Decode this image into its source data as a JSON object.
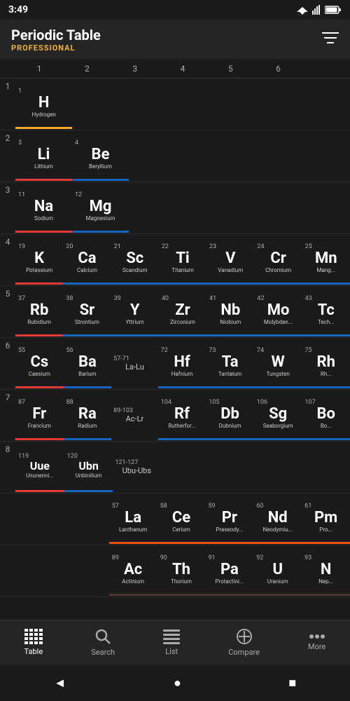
{
  "status": {
    "time": "3:49"
  },
  "header": {
    "title": "Periodic Table",
    "subtitle": "PROFESSIONAL",
    "filter_label": "filter"
  },
  "col_headers": [
    "1",
    "2",
    "3",
    "4",
    "5",
    "6"
  ],
  "periods": [
    {
      "label": "1",
      "cells": [
        {
          "num": "1",
          "symbol": "H",
          "name": "Hydrogen",
          "cat": "nonmetal",
          "col": 1
        },
        {
          "num": "",
          "symbol": "",
          "name": "",
          "cat": "empty",
          "col": 2
        },
        {
          "num": "",
          "symbol": "",
          "name": "",
          "cat": "empty",
          "col": 3
        },
        {
          "num": "",
          "symbol": "",
          "name": "",
          "cat": "empty",
          "col": 4
        },
        {
          "num": "",
          "symbol": "",
          "name": "",
          "cat": "empty",
          "col": 5
        },
        {
          "num": "",
          "symbol": "",
          "name": "",
          "cat": "empty",
          "col": 6
        }
      ]
    },
    {
      "label": "2",
      "cells": [
        {
          "num": "3",
          "symbol": "Li",
          "name": "Lithium",
          "cat": "alkali",
          "col": 1
        },
        {
          "num": "4",
          "symbol": "Be",
          "name": "Beryllium",
          "cat": "alkaline",
          "col": 2
        },
        {
          "num": "",
          "symbol": "",
          "name": "",
          "cat": "empty",
          "col": 3
        },
        {
          "num": "",
          "symbol": "",
          "name": "",
          "cat": "empty",
          "col": 4
        },
        {
          "num": "",
          "symbol": "",
          "name": "",
          "cat": "empty",
          "col": 5
        },
        {
          "num": "",
          "symbol": "",
          "name": "",
          "cat": "empty",
          "col": 6
        }
      ]
    },
    {
      "label": "3",
      "cells": [
        {
          "num": "11",
          "symbol": "Na",
          "name": "Sodium",
          "cat": "alkali",
          "col": 1
        },
        {
          "num": "12",
          "symbol": "Mg",
          "name": "Magnesium",
          "cat": "alkaline",
          "col": 2
        },
        {
          "num": "",
          "symbol": "",
          "name": "",
          "cat": "empty",
          "col": 3
        },
        {
          "num": "",
          "symbol": "",
          "name": "",
          "cat": "empty",
          "col": 4
        },
        {
          "num": "",
          "symbol": "",
          "name": "",
          "cat": "empty",
          "col": 5
        },
        {
          "num": "",
          "symbol": "",
          "name": "",
          "cat": "empty",
          "col": 6
        }
      ]
    },
    {
      "label": "4",
      "cells": [
        {
          "num": "19",
          "symbol": "K",
          "name": "Potassium",
          "cat": "alkali",
          "col": 1
        },
        {
          "num": "20",
          "symbol": "Ca",
          "name": "Calcium",
          "cat": "alkaline",
          "col": 2
        },
        {
          "num": "21",
          "symbol": "Sc",
          "name": "Scandium",
          "cat": "transition",
          "col": 3
        },
        {
          "num": "22",
          "symbol": "Ti",
          "name": "Titanium",
          "cat": "transition",
          "col": 4
        },
        {
          "num": "23",
          "symbol": "V",
          "name": "Vanadium",
          "cat": "transition",
          "col": 5
        },
        {
          "num": "24",
          "symbol": "Cr",
          "name": "Chromium",
          "cat": "transition",
          "col": 6
        },
        {
          "num": "25",
          "symbol": "Mn",
          "name": "Mang...",
          "cat": "transition",
          "col": 7
        }
      ]
    },
    {
      "label": "5",
      "cells": [
        {
          "num": "37",
          "symbol": "Rb",
          "name": "Rubidium",
          "cat": "alkali",
          "col": 1
        },
        {
          "num": "38",
          "symbol": "Sr",
          "name": "Strontium",
          "cat": "alkaline",
          "col": 2
        },
        {
          "num": "39",
          "symbol": "Y",
          "name": "Yttrium",
          "cat": "transition",
          "col": 3
        },
        {
          "num": "40",
          "symbol": "Zr",
          "name": "Zirconium",
          "cat": "transition",
          "col": 4
        },
        {
          "num": "41",
          "symbol": "Nb",
          "name": "Niobium",
          "cat": "transition",
          "col": 5
        },
        {
          "num": "42",
          "symbol": "Mo",
          "name": "Molybden...",
          "cat": "transition",
          "col": 6
        },
        {
          "num": "43",
          "symbol": "Tc",
          "name": "Tech...",
          "cat": "transition",
          "col": 7
        }
      ]
    },
    {
      "label": "6",
      "cells": [
        {
          "num": "55",
          "symbol": "Cs",
          "name": "Caesium",
          "cat": "alkali",
          "col": 1
        },
        {
          "num": "56",
          "symbol": "Ba",
          "name": "Barium",
          "cat": "alkaline",
          "col": 2
        },
        {
          "num": "57-71",
          "symbol": "La-Lu",
          "name": "",
          "cat": "range",
          "col": 3
        },
        {
          "num": "72",
          "symbol": "Hf",
          "name": "Hafnium",
          "cat": "transition",
          "col": 4
        },
        {
          "num": "73",
          "symbol": "Ta",
          "name": "Tantalum",
          "cat": "transition",
          "col": 5
        },
        {
          "num": "74",
          "symbol": "W",
          "name": "Tungsten",
          "cat": "transition",
          "col": 6
        },
        {
          "num": "75",
          "symbol": "Rh",
          "name": "Rh...",
          "cat": "transition",
          "col": 7
        }
      ]
    },
    {
      "label": "7",
      "cells": [
        {
          "num": "87",
          "symbol": "Fr",
          "name": "Francium",
          "cat": "alkali",
          "col": 1
        },
        {
          "num": "88",
          "symbol": "Ra",
          "name": "Radium",
          "cat": "alkaline",
          "col": 2
        },
        {
          "num": "89-103",
          "symbol": "Ac-Lr",
          "name": "",
          "cat": "range",
          "col": 3
        },
        {
          "num": "104",
          "symbol": "Rf",
          "name": "Rutherfor...",
          "cat": "transition",
          "col": 4
        },
        {
          "num": "105",
          "symbol": "Db",
          "name": "Dubnium",
          "cat": "transition",
          "col": 5
        },
        {
          "num": "106",
          "symbol": "Sg",
          "name": "Seaborgium",
          "cat": "transition",
          "col": 6
        },
        {
          "num": "107",
          "symbol": "Bo",
          "name": "Bo...",
          "cat": "transition",
          "col": 7
        }
      ]
    },
    {
      "label": "8",
      "cells": [
        {
          "num": "119",
          "symbol": "Uue",
          "name": "Ununenni...",
          "cat": "alkali",
          "col": 1
        },
        {
          "num": "120",
          "symbol": "Ubn",
          "name": "Unbinilium",
          "cat": "alkaline",
          "col": 2
        },
        {
          "num": "121-127",
          "symbol": "Ubu-Ubs",
          "name": "",
          "cat": "range",
          "col": 3
        },
        {
          "num": "",
          "symbol": "",
          "name": "",
          "cat": "empty",
          "col": 4
        },
        {
          "num": "",
          "symbol": "",
          "name": "",
          "cat": "empty",
          "col": 5
        },
        {
          "num": "",
          "symbol": "",
          "name": "",
          "cat": "empty",
          "col": 6
        },
        {
          "num": "",
          "symbol": "",
          "name": "",
          "cat": "empty",
          "col": 7
        }
      ]
    }
  ],
  "lan_row": {
    "cells": [
      {
        "num": "57",
        "symbol": "La",
        "name": "Lanthanum",
        "cat": "lanthanide"
      },
      {
        "num": "58",
        "symbol": "Ce",
        "name": "Cerium",
        "cat": "lanthanide"
      },
      {
        "num": "59",
        "symbol": "Pr",
        "name": "Praseody...",
        "cat": "lanthanide"
      },
      {
        "num": "60",
        "symbol": "Nd",
        "name": "Neodymiu...",
        "cat": "lanthanide"
      },
      {
        "num": "61",
        "symbol": "Pm",
        "name": "Pro...",
        "cat": "lanthanide"
      }
    ]
  },
  "act_row": {
    "cells": [
      {
        "num": "89",
        "symbol": "Ac",
        "name": "Actinium",
        "cat": "actinide"
      },
      {
        "num": "90",
        "symbol": "Th",
        "name": "Thorium",
        "cat": "actinide"
      },
      {
        "num": "91",
        "symbol": "Pa",
        "name": "Protactini...",
        "cat": "actinide"
      },
      {
        "num": "92",
        "symbol": "U",
        "name": "Uranium",
        "cat": "actinide"
      },
      {
        "num": "93",
        "symbol": "N",
        "name": "Nep...",
        "cat": "actinide"
      }
    ]
  },
  "bottom_nav": {
    "items": [
      {
        "label": "Table",
        "icon": "⊞",
        "active": true
      },
      {
        "label": "Search",
        "icon": "⌕",
        "active": false
      },
      {
        "label": "List",
        "icon": "≡",
        "active": false
      },
      {
        "label": "Compare",
        "icon": "⊕",
        "active": false
      },
      {
        "label": "More",
        "icon": "···",
        "active": false
      }
    ]
  },
  "sys_nav": {
    "back": "◄",
    "home": "●",
    "recents": "■"
  }
}
